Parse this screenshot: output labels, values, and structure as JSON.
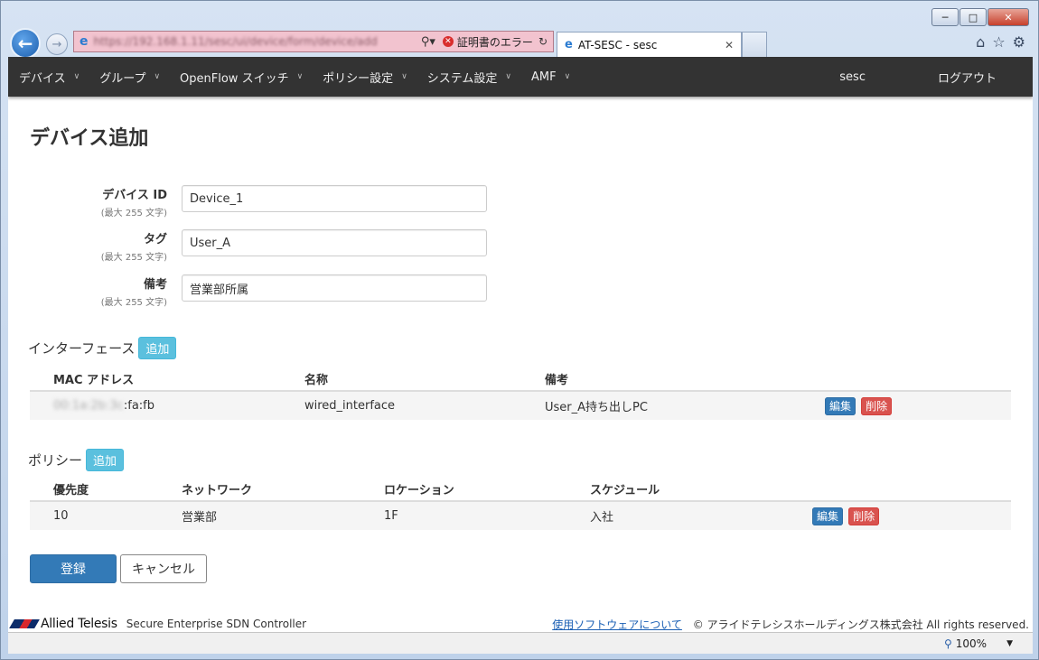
{
  "browser": {
    "url": "https://192.168.1.11/sesc/ui/device/form/device/add",
    "cert_error": "証明書のエラー",
    "tab_title": "AT-SESC - sesc",
    "zoom": "100%"
  },
  "navbar": {
    "items": [
      "デバイス",
      "グループ",
      "OpenFlow スイッチ",
      "ポリシー設定",
      "システム設定",
      "AMF"
    ],
    "user": "sesc",
    "logout": "ログアウト"
  },
  "page": {
    "title": "デバイス追加"
  },
  "form": {
    "device_id": {
      "label": "デバイス ID",
      "hint": "(最大 255 文字)",
      "value": "Device_1"
    },
    "tag": {
      "label": "タグ",
      "hint": "(最大 255 文字)",
      "value": "User_A"
    },
    "note": {
      "label": "備考",
      "hint": "(最大 255 文字)",
      "value": "営業部所属"
    }
  },
  "interfaces": {
    "title": "インターフェース",
    "add_label": "追加",
    "headers": [
      "MAC アドレス",
      "名称",
      "備考"
    ],
    "rows": [
      {
        "mac_hidden": "00:1a:2b:3c",
        "mac_visible": ":fa:fb",
        "name": "wired_interface",
        "note": "User_A持ち出しPC"
      }
    ]
  },
  "policies": {
    "title": "ポリシー",
    "add_label": "追加",
    "headers": [
      "優先度",
      "ネットワーク",
      "ロケーション",
      "スケジュール"
    ],
    "rows": [
      {
        "priority": "10",
        "network": "営業部",
        "location": "1F",
        "schedule": "入社"
      }
    ]
  },
  "row_actions": {
    "edit": "編集",
    "delete": "削除"
  },
  "buttons": {
    "submit": "登録",
    "cancel": "キャンセル"
  },
  "footer": {
    "brand": "Allied Telesis",
    "product": "Secure Enterprise SDN Controller",
    "link": "使用ソフトウェアについて",
    "copyright": "© アライドテレシスホールディングス株式会社 All rights reserved."
  },
  "colors": {
    "navbar_bg": "#333333",
    "primary": "#337ab7",
    "info": "#5bc0de",
    "danger": "#d9534f"
  }
}
